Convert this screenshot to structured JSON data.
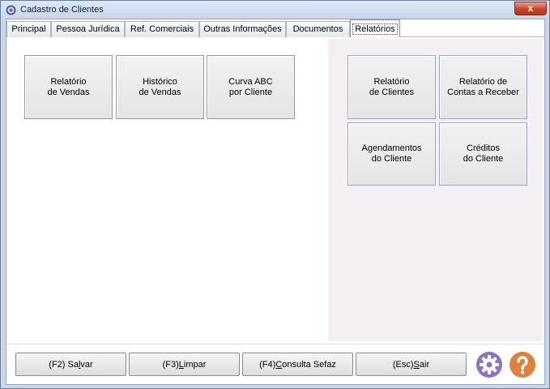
{
  "window": {
    "title": "Cadastro de Clientes",
    "close_label": "x"
  },
  "tabs": [
    {
      "label": "Principal"
    },
    {
      "label": "Pessoa Jurídica"
    },
    {
      "label": "Ref. Comerciais"
    },
    {
      "label": "Outras Informações"
    },
    {
      "label": "Documentos"
    },
    {
      "label": "Relatórios"
    }
  ],
  "left_buttons": [
    {
      "line1": "Relatório",
      "line2": "de Vendas"
    },
    {
      "line1": "Histórico",
      "line2": "de Vendas"
    },
    {
      "line1": "Curva ABC",
      "line2": "por Cliente"
    }
  ],
  "right_buttons": [
    {
      "line1": "Relatório",
      "line2": "de Clientes"
    },
    {
      "line1": "Relatório de",
      "line2": "Contas a Receber"
    },
    {
      "line1": "Agendamentos",
      "line2": "do Cliente"
    },
    {
      "line1": "Créditos",
      "line2": "do Cliente"
    }
  ],
  "footer": {
    "save": {
      "prefix": "(F2) Sa",
      "key": "l",
      "suffix": "var"
    },
    "clear": {
      "prefix": "(F3) ",
      "key": "L",
      "suffix": "impar"
    },
    "sefaz": {
      "prefix": "(F4) ",
      "key": "C",
      "suffix": "onsulta Sefaz"
    },
    "exit": {
      "prefix": "(Esc) ",
      "key": "S",
      "suffix": "air"
    }
  },
  "colors": {
    "gear": "#8f72c6",
    "help": "#e0813a"
  }
}
